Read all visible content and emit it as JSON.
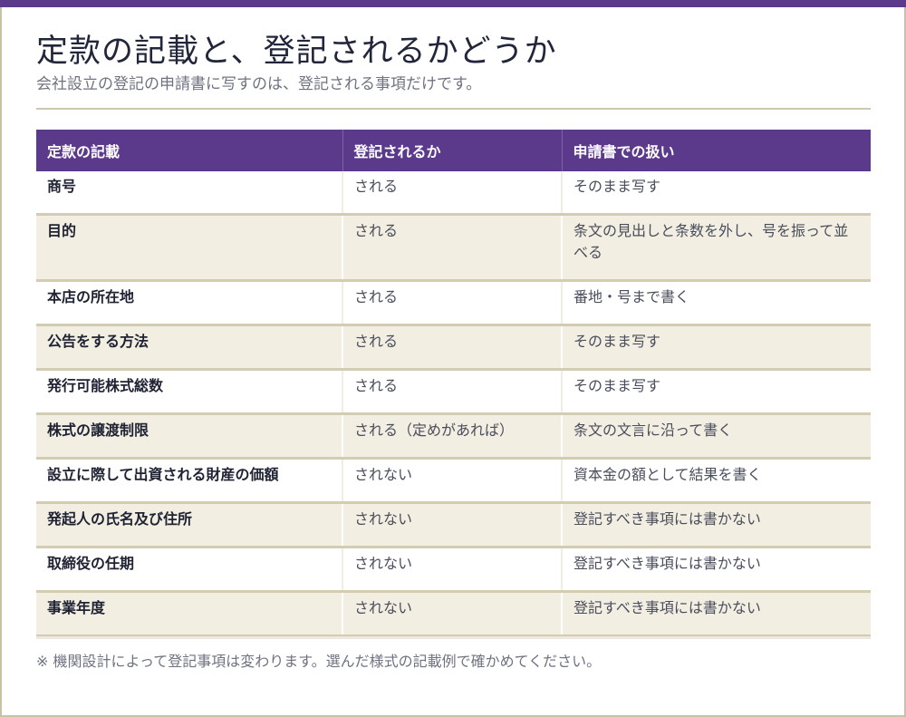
{
  "title": "定款の記載と、登記されるかどうか",
  "subtitle": "会社設立の登記の申請書に写すのは、登記される事項だけです。",
  "table": {
    "headers": [
      "定款の記載",
      "登記されるか",
      "申請書での扱い"
    ],
    "rows": [
      [
        "商号",
        "される",
        "そのまま写す"
      ],
      [
        "目的",
        "される",
        "条文の見出しと条数を外し、号を振って並べる"
      ],
      [
        "本店の所在地",
        "される",
        "番地・号まで書く"
      ],
      [
        "公告をする方法",
        "される",
        "そのまま写す"
      ],
      [
        "発行可能株式総数",
        "される",
        "そのまま写す"
      ],
      [
        "株式の譲渡制限",
        "される（定めがあれば）",
        "条文の文言に沿って書く"
      ],
      [
        "設立に際して出資される財産の価額",
        "されない",
        "資本金の額として結果を書く"
      ],
      [
        "発起人の氏名及び住所",
        "されない",
        "登記すべき事項には書かない"
      ],
      [
        "取締役の任期",
        "されない",
        "登記すべき事項には書かない"
      ],
      [
        "事業年度",
        "されない",
        "登記すべき事項には書かない"
      ]
    ]
  },
  "footnote": "※ 機関設計によって登記事項は変わります。選んだ様式の記載例で確かめてください。",
  "colors": {
    "accent": "#5b3a8c",
    "row_alt": "#f2eee2",
    "rule": "#cfc8b0"
  }
}
